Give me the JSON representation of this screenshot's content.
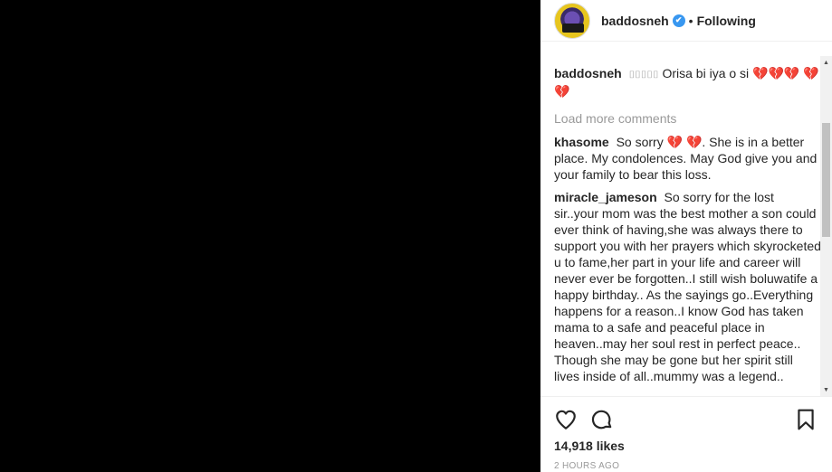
{
  "header": {
    "username": "baddosneh",
    "verified_mark": "✔",
    "separator": "•",
    "follow_status": "Following"
  },
  "comments": {
    "load_more": "Load more comments",
    "items": [
      {
        "user": "baddosneh",
        "text": "Orisa bi iya o si"
      },
      {
        "user": "khasome",
        "text_before": "So sorry",
        "text_after": ". She is in a better place. My condolences. May God give you and your family to bear this loss."
      },
      {
        "user": "miracle_jameson",
        "text": "So sorry for the lost sir..your mom was the best mother a son could ever think of having,she was always there to support you with her prayers which skyrocketed u to fame,her part in your life and career will never ever be forgotten..I still wish boluwatife a happy birthday.. As the sayings go..Everything happens for a reason..I know God has taken mama to a safe and peaceful place in heaven..may her soul rest in perfect peace.. Though she may be gone but her spirit still lives inside of all..mummy was a legend.."
      }
    ]
  },
  "icons": {
    "broken_heart": "💔",
    "placeholder_glyph": "⌷⌷⌷⌷⌷"
  },
  "actions": {
    "likes": "14,918 likes",
    "time": "2 HOURS AGO"
  },
  "scrollbar": {
    "up_arrow": "▲",
    "down_arrow": "▼"
  }
}
